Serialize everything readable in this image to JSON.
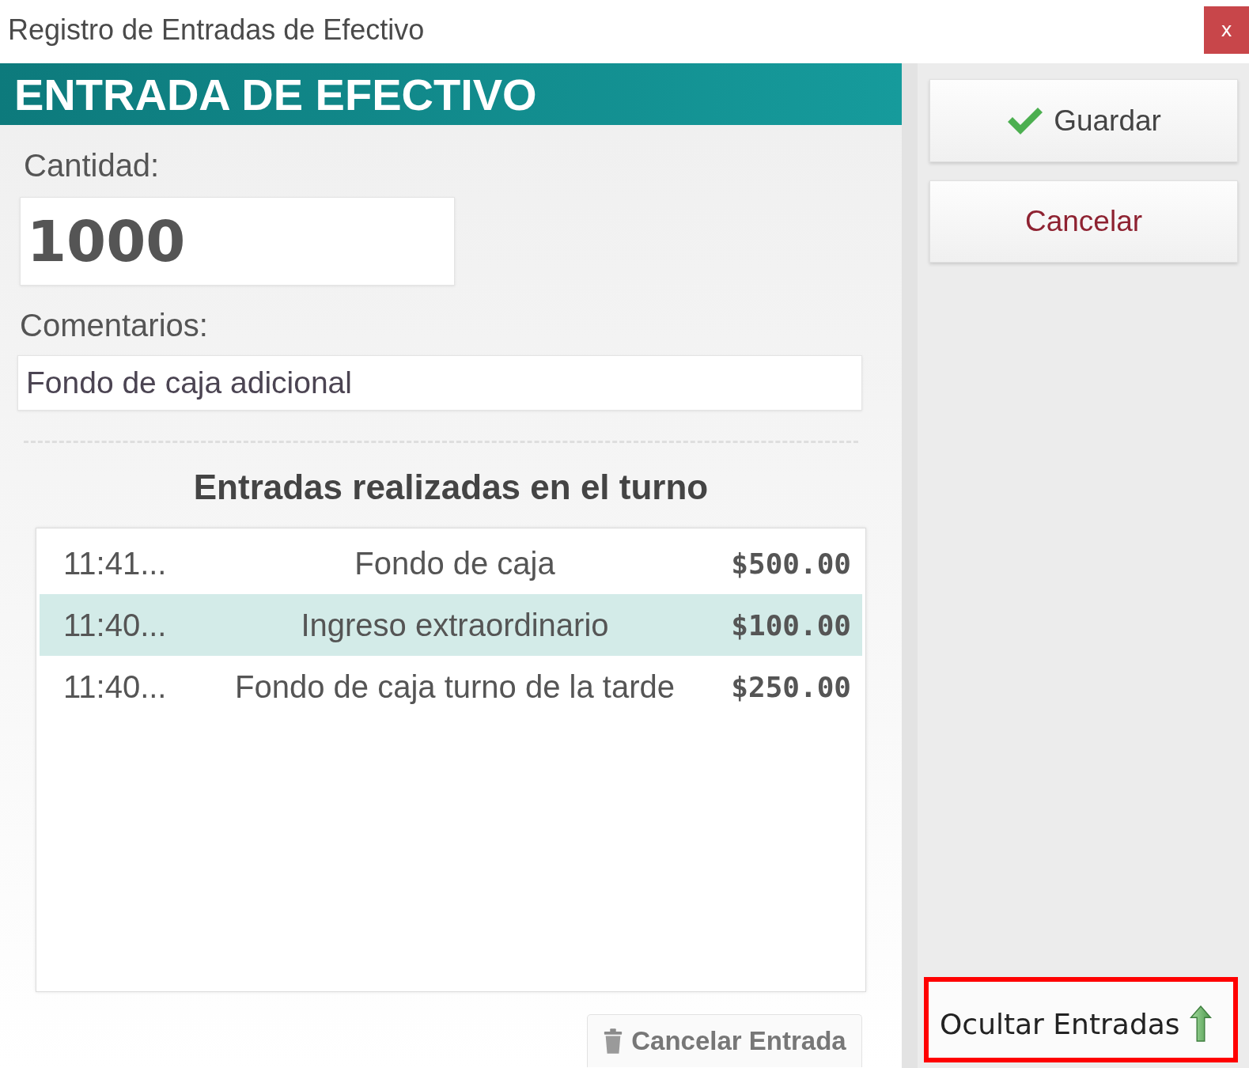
{
  "window": {
    "title": "Registro de Entradas de Efectivo",
    "close_label": "x"
  },
  "form": {
    "header": "ENTRADA DE EFECTIVO",
    "amount": {
      "label": "Cantidad:",
      "value": "1000"
    },
    "comments": {
      "label": "Comentarios:",
      "value": "Fondo de caja adicional"
    }
  },
  "entries": {
    "title": "Entradas realizadas en el turno",
    "rows": [
      {
        "time": "11:41...",
        "description": "Fondo de caja",
        "amount": "$500.00",
        "selected": false
      },
      {
        "time": "11:40...",
        "description": "Ingreso extraordinario",
        "amount": "$100.00",
        "selected": true
      },
      {
        "time": "11:40...",
        "description": "Fondo de caja turno de la tarde",
        "amount": "$250.00",
        "selected": false
      }
    ],
    "cancel_button": "Cancelar Entrada"
  },
  "actions": {
    "save": "Guardar",
    "cancel": "Cancelar"
  },
  "toggle_entries": {
    "label": "Ocultar Entradas",
    "highlighted": true
  }
}
